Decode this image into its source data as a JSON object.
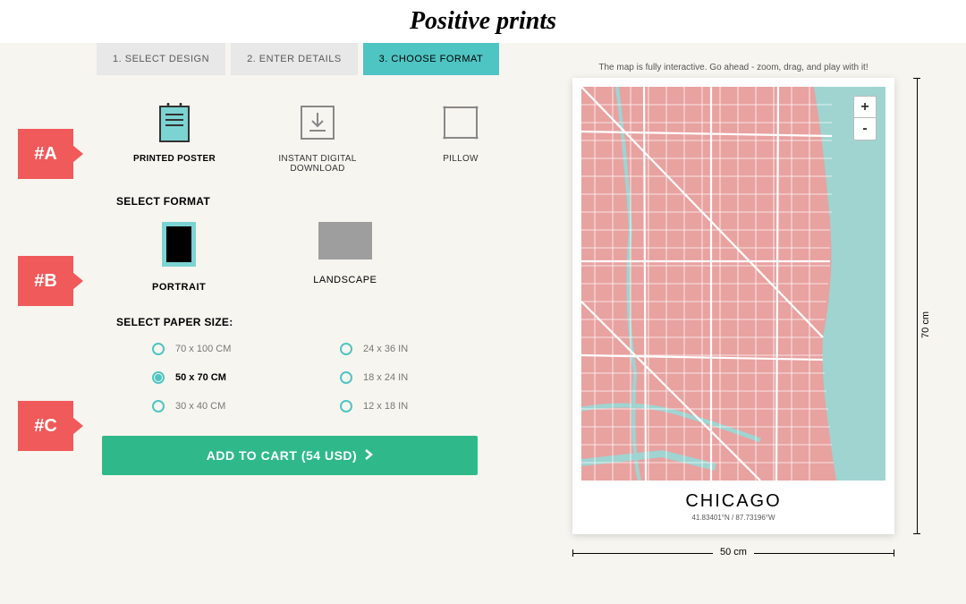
{
  "logo": "Positive prints",
  "tabs": [
    {
      "label": "1. SELECT DESIGN",
      "active": false
    },
    {
      "label": "2. ENTER DETAILS",
      "active": false
    },
    {
      "label": "3. CHOOSE FORMAT",
      "active": true
    }
  ],
  "callouts": {
    "a": "#A",
    "b": "#B",
    "c": "#C"
  },
  "productTypes": [
    {
      "key": "printed",
      "label": "PRINTED POSTER",
      "selected": true
    },
    {
      "key": "digital",
      "label": "INSTANT DIGITAL DOWNLOAD",
      "selected": false
    },
    {
      "key": "pillow",
      "label": "PILLOW",
      "selected": false
    }
  ],
  "sections": {
    "format": "SELECT FORMAT",
    "paperSize": "SELECT PAPER SIZE:"
  },
  "formats": [
    {
      "key": "portrait",
      "label": "PORTRAIT",
      "selected": true
    },
    {
      "key": "landscape",
      "label": "LANDSCAPE",
      "selected": false
    }
  ],
  "sizes": [
    {
      "label": "70 x 100 CM",
      "selected": false
    },
    {
      "label": "24 x 36 IN",
      "selected": false
    },
    {
      "label": "50 x 70 CM",
      "selected": true
    },
    {
      "label": "18 x 24 IN",
      "selected": false
    },
    {
      "label": "30 x 40 CM",
      "selected": false
    },
    {
      "label": "12 x 18 IN",
      "selected": false
    }
  ],
  "cartButton": "ADD TO CART (54 USD)",
  "map": {
    "hint": "The map is fully interactive. Go ahead - zoom, drag, and play with it!",
    "zoomIn": "+",
    "zoomOut": "-",
    "title": "CHICAGO",
    "coords": "41.83401°N / 87.73196°W",
    "widthLabel": "50 cm",
    "heightLabel": "70 cm"
  }
}
